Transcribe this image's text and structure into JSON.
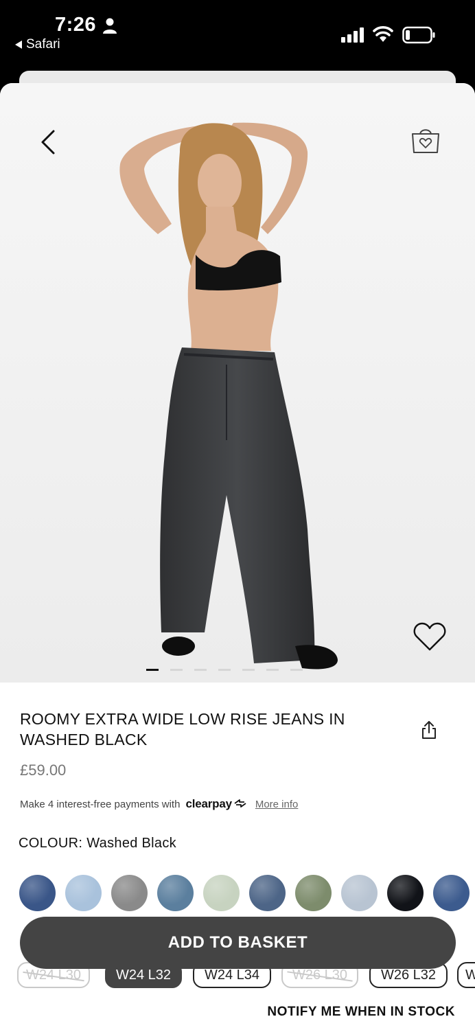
{
  "status_bar": {
    "time": "7:26",
    "back_app": "Safari"
  },
  "product": {
    "title": "ROOMY EXTRA WIDE LOW RISE JEANS IN WASHED BLACK",
    "price": "£59.00",
    "image_count": 7,
    "active_image": 1
  },
  "clearpay": {
    "text": "Make 4 interest-free payments with",
    "logo": "clearpay",
    "more_info": "More info"
  },
  "colour": {
    "label": "COLOUR:",
    "value": "Washed Black",
    "swatches": [
      "#3a5688",
      "#a9c2dc",
      "#8a8a8a",
      "#5b7f9e",
      "#c7d3c0",
      "#4d6587",
      "#7d8c6c",
      "#b8c4d2",
      "#111318",
      "#3c5b8e"
    ]
  },
  "actions": {
    "add_to_basket": "ADD TO BASKET",
    "notify": "NOTIFY ME WHEN IN STOCK"
  },
  "sizes": [
    {
      "label": "W24 L30",
      "state": "out-of-stock"
    },
    {
      "label": "W24 L32",
      "state": "selected"
    },
    {
      "label": "W24 L34",
      "state": "available"
    },
    {
      "label": "W26 L30",
      "state": "out-of-stock"
    },
    {
      "label": "W26 L32",
      "state": "available"
    },
    {
      "label": "W",
      "state": "available"
    }
  ],
  "icons": {
    "back": "chevron-left-icon",
    "bag": "shopping-bag-heart-icon",
    "wishlist": "heart-icon",
    "share": "share-icon"
  },
  "colors": {
    "button_dark": "#444444",
    "page_bg": "#ffffff",
    "status_bg": "#000000"
  }
}
